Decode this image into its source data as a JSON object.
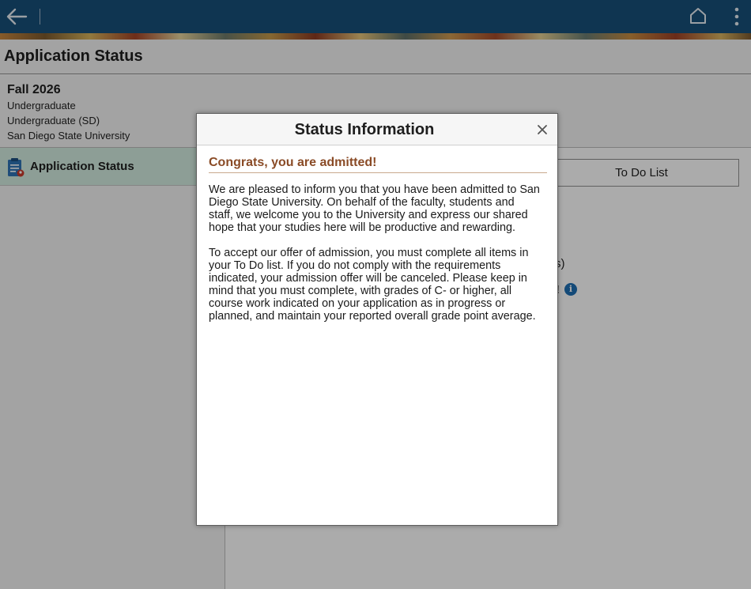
{
  "header": {
    "back_icon": "back-arrow-icon",
    "home_icon": "home-icon",
    "menu_icon": "kebab-menu-icon"
  },
  "page": {
    "title": "Application Status"
  },
  "context": {
    "term": "Fall 2026",
    "career": "Undergraduate",
    "program": "Undergraduate (SD)",
    "institution": "San Diego State University"
  },
  "nav": {
    "items": [
      {
        "label": "Application Status",
        "icon": "application-document-icon",
        "selected": true
      }
    ]
  },
  "main": {
    "todo_button": "To Do List",
    "partial_text_1": "s)",
    "partial_text_2": "!"
  },
  "modal": {
    "title": "Status Information",
    "close_icon": "close-icon",
    "heading": "Congrats, you are admitted!",
    "paragraph1_lines": [
      "We are pleased to inform you that you have been admitted to San",
      "Diego State University. On behalf of the faculty, students and",
      "staff, we welcome you to the University and express our shared",
      "hope that your studies here will be productive and rewarding."
    ],
    "paragraph2_lines": [
      "To accept our offer of admission, you must complete all items in",
      "your To Do list. If you do not comply with the requirements",
      "indicated, your admission offer will be canceled. Please keep in",
      "mind that you must complete, with grades of C- or higher, all",
      "course work indicated on your application as in progress or",
      "planned, and maintain your reported overall grade point average."
    ]
  },
  "colors": {
    "topbar": "#17507a",
    "nav_selected": "#d3ece0",
    "heading_brown": "#8a4b26",
    "info_blue": "#1e6fb4"
  }
}
